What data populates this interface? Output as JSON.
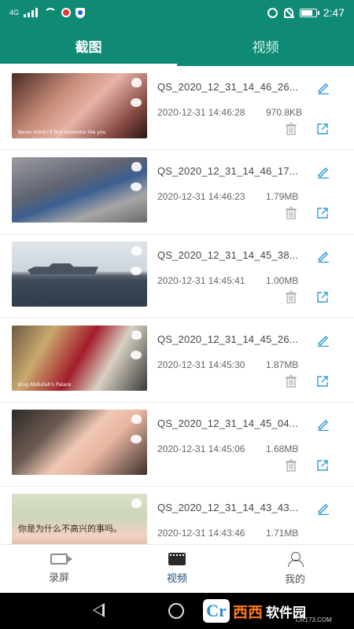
{
  "status_bar": {
    "network": "4G",
    "time": "2:47"
  },
  "tabs": [
    {
      "label": "截图",
      "active": true
    },
    {
      "label": "视频",
      "active": false
    }
  ],
  "files": [
    {
      "name": "QS_2020_12_31_14_46_26...",
      "date": "2020-12-31 14:46:28",
      "size": "970.8KB"
    },
    {
      "name": "QS_2020_12_31_14_46_17...",
      "date": "2020-12-31 14:46:23",
      "size": "1.79MB"
    },
    {
      "name": "QS_2020_12_31_14_45_38...",
      "date": "2020-12-31 14:45:41",
      "size": "1.00MB"
    },
    {
      "name": "QS_2020_12_31_14_45_26...",
      "date": "2020-12-31 14:45:30",
      "size": "1.87MB"
    },
    {
      "name": "QS_2020_12_31_14_45_04...",
      "date": "2020-12-31 14:45:06",
      "size": "1.68MB"
    },
    {
      "name": "QS_2020_12_31_14_43_43...",
      "date": "2020-12-31 14:43:46",
      "size": "1.71MB"
    }
  ],
  "thumb_captions": {
    "first": "Never mind I'll find someone like you",
    "fourth": "King Abdullah's Palace",
    "sixth": "你是为什么不高兴的事吗。"
  },
  "bottom_nav": [
    {
      "label": "录屏",
      "icon": "video-camera-icon",
      "active": false
    },
    {
      "label": "视频",
      "icon": "film-icon",
      "active": true
    },
    {
      "label": "我的",
      "icon": "person-icon",
      "active": false
    }
  ],
  "watermark": {
    "logo": "Cr",
    "text1": "西西",
    "text2": "软件园",
    "url": "CR173.COM"
  },
  "colors": {
    "primary": "#0f8a74",
    "icon_blue": "#2f9bd6",
    "nav_active": "#1f4f7d"
  }
}
